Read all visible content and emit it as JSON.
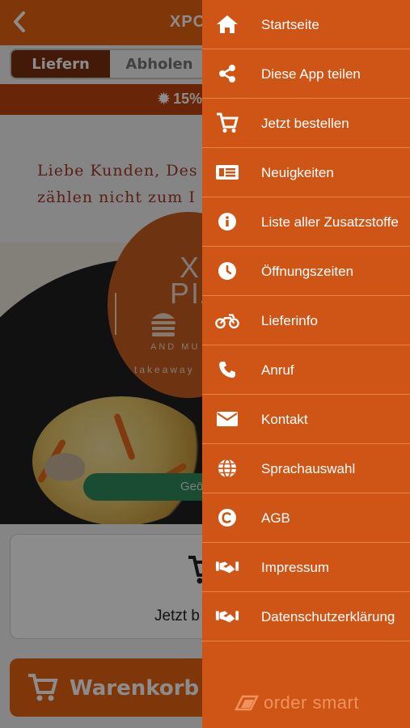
{
  "header": {
    "title": "XPO",
    "back_icon": "chevron-left-icon"
  },
  "mode_toggle": {
    "options": [
      "Liefern",
      "Abholen"
    ],
    "selected": "Liefern"
  },
  "promo": {
    "text": "15%"
  },
  "welcome": {
    "line1": "Liebe Kunden, Des",
    "line2": "zählen nicht zum I"
  },
  "logo": {
    "line1": "XI",
    "line2": "PIZ",
    "sub": "AND MU",
    "takeaway": "takeaway"
  },
  "open_status": {
    "text": "Geö"
  },
  "order_card": {
    "label": "Jetzt b"
  },
  "cart_button": {
    "label": "Warenkorb"
  },
  "drawer": {
    "items": [
      {
        "label": "Startseite",
        "icon": "home-icon"
      },
      {
        "label": "Diese App teilen",
        "icon": "share-icon"
      },
      {
        "label": "Jetzt bestellen",
        "icon": "cart-icon"
      },
      {
        "label": "Neuigkeiten",
        "icon": "news-icon"
      },
      {
        "label": "Liste aller Zusatzstoffe",
        "icon": "info-icon"
      },
      {
        "label": "Öffnungszeiten",
        "icon": "clock-icon"
      },
      {
        "label": "Lieferinfo",
        "icon": "motorbike-icon"
      },
      {
        "label": "Anruf",
        "icon": "phone-icon"
      },
      {
        "label": "Kontakt",
        "icon": "envelope-icon"
      },
      {
        "label": "Sprachauswahl",
        "icon": "globe-icon"
      },
      {
        "label": "AGB",
        "icon": "copyright-icon"
      },
      {
        "label": "Impressum",
        "icon": "handshake-icon"
      },
      {
        "label": "Datenschutzerklärung",
        "icon": "handshake-icon"
      }
    ],
    "brand": "order smart"
  },
  "colors": {
    "primary": "#e8630f",
    "drawer": "#cf5517",
    "toggle_active": "#7a2f10"
  }
}
